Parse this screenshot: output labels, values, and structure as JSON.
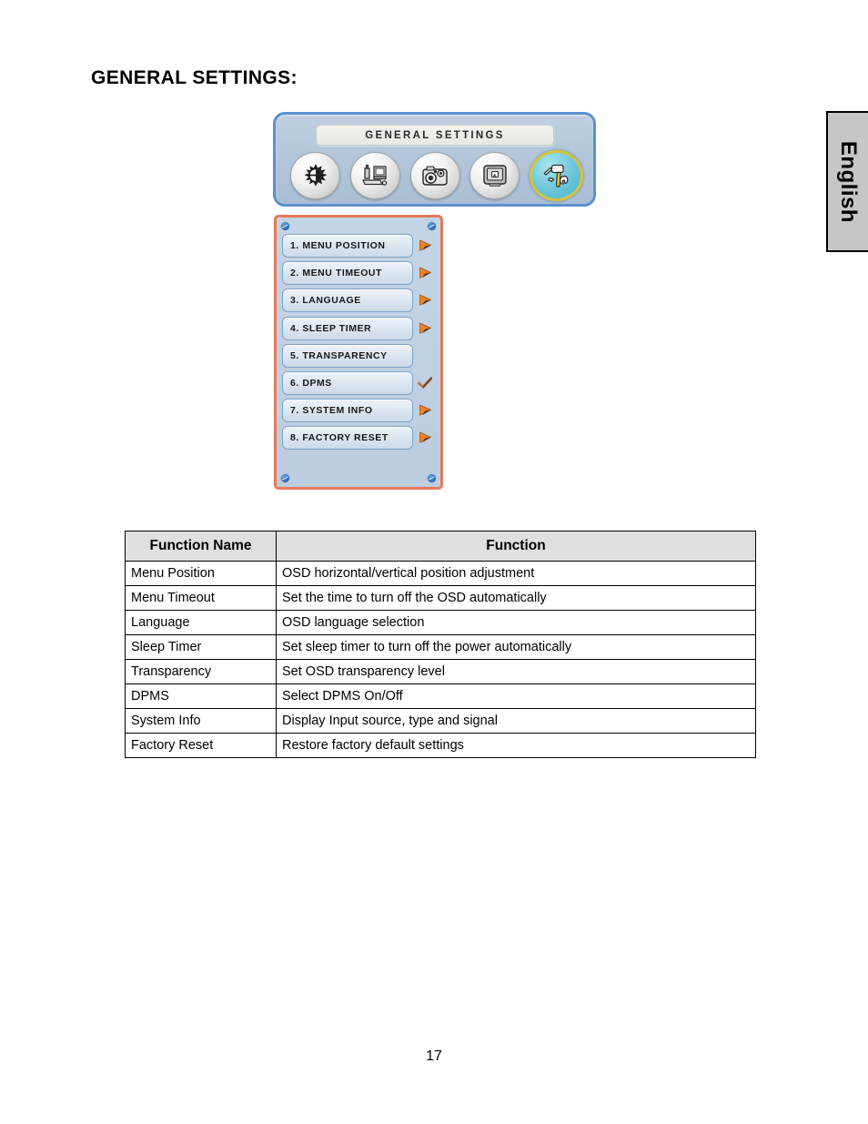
{
  "page": {
    "heading": "GENERAL SETTINGS:",
    "number": "17",
    "language_tab": "English"
  },
  "osd": {
    "title": "GENERAL SETTINGS",
    "icons": [
      {
        "name": "brightness-contrast-icon",
        "label": "Brightness / Contrast",
        "selected": false
      },
      {
        "name": "geometry-adjust-icon",
        "label": "Geometry Adjust",
        "selected": false
      },
      {
        "name": "color-settings-icon",
        "label": "Color Settings",
        "selected": false
      },
      {
        "name": "image-settings-icon",
        "label": "Image Settings",
        "selected": false
      },
      {
        "name": "general-settings-tools-icon",
        "label": "General Settings",
        "selected": true
      }
    ],
    "icon_selected_ring_color": "#d4c33c",
    "icon_selected_fill_color": "#6cc5d9",
    "panel_border_color": "#5b92cc",
    "menu_border_color": "#e8795a",
    "marker_color": "#f08021",
    "menu_items": [
      {
        "label": "1. MENU POSITION",
        "marker": "arrow"
      },
      {
        "label": "2. MENU TIMEOUT",
        "marker": "arrow"
      },
      {
        "label": "3. LANGUAGE",
        "marker": "arrow"
      },
      {
        "label": "4. SLEEP TIMER",
        "marker": "arrow"
      },
      {
        "label": "5. TRANSPARENCY",
        "marker": "none"
      },
      {
        "label": "6. DPMS",
        "marker": "check"
      },
      {
        "label": "7. SYSTEM INFO",
        "marker": "arrow"
      },
      {
        "label": "8. FACTORY RESET",
        "marker": "arrow"
      }
    ]
  },
  "table": {
    "headers": [
      "Function Name",
      "Function"
    ],
    "rows": [
      [
        "Menu Position",
        "OSD horizontal/vertical position adjustment"
      ],
      [
        "Menu Timeout",
        "Set the time to turn off the OSD automatically"
      ],
      [
        "Language",
        "OSD language selection"
      ],
      [
        "Sleep Timer",
        "Set sleep timer to turn off the power automatically"
      ],
      [
        "Transparency",
        "Set OSD transparency level"
      ],
      [
        "DPMS",
        "Select DPMS On/Off"
      ],
      [
        "System Info",
        "Display Input source, type and signal"
      ],
      [
        "Factory Reset",
        "Restore factory default settings"
      ]
    ]
  }
}
